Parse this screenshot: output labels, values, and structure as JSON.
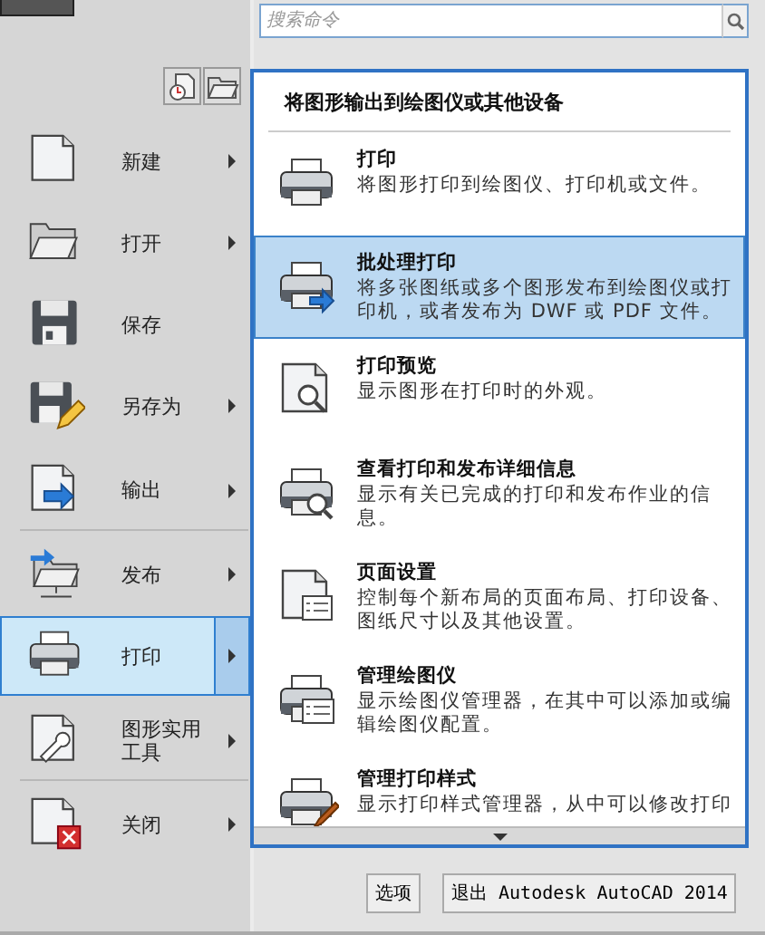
{
  "search": {
    "placeholder": "搜索命令"
  },
  "menu": [
    {
      "label": "新建",
      "has_submenu": true,
      "selected": false,
      "divider_after": false
    },
    {
      "label": "打开",
      "has_submenu": true,
      "selected": false,
      "divider_after": false
    },
    {
      "label": "保存",
      "has_submenu": false,
      "selected": false,
      "divider_after": false
    },
    {
      "label": "另存为",
      "has_submenu": true,
      "selected": false,
      "divider_after": false
    },
    {
      "label": "输出",
      "has_submenu": true,
      "selected": false,
      "divider_after": true
    },
    {
      "label": "发布",
      "has_submenu": true,
      "selected": false,
      "divider_after": false
    },
    {
      "label": "打印",
      "has_submenu": true,
      "selected": true,
      "divider_after": false
    },
    {
      "label": "图形实用工具",
      "has_submenu": true,
      "selected": false,
      "divider_after": true
    },
    {
      "label": "关闭",
      "has_submenu": true,
      "selected": false,
      "divider_after": false
    }
  ],
  "submenu": {
    "title": "将图形输出到绘图仪或其他设备",
    "items": [
      {
        "title": "打印",
        "description": "将图形打印到绘图仪、打印机或文件。",
        "selected": false
      },
      {
        "title": "批处理打印",
        "description": "将多张图纸或多个图形发布到绘图仪或打印机，或者发布为 DWF 或 PDF 文件。",
        "selected": true
      },
      {
        "title": "打印预览",
        "description": "显示图形在打印时的外观。",
        "selected": false
      },
      {
        "title": "查看打印和发布详细信息",
        "description": "显示有关已完成的打印和发布作业的信息。",
        "selected": false
      },
      {
        "title": "页面设置",
        "description": "控制每个新布局的页面布局、打印设备、图纸尺寸以及其他设置。",
        "selected": false
      },
      {
        "title": "管理绘图仪",
        "description": "显示绘图仪管理器，在其中可以添加或编辑绘图仪配置。",
        "selected": false
      },
      {
        "title": "管理打印样式",
        "description": "显示打印样式管理器，从中可以修改打印",
        "selected": false
      }
    ]
  },
  "buttons": [
    "选项",
    "退出 Autodesk AutoCAD 2014"
  ]
}
